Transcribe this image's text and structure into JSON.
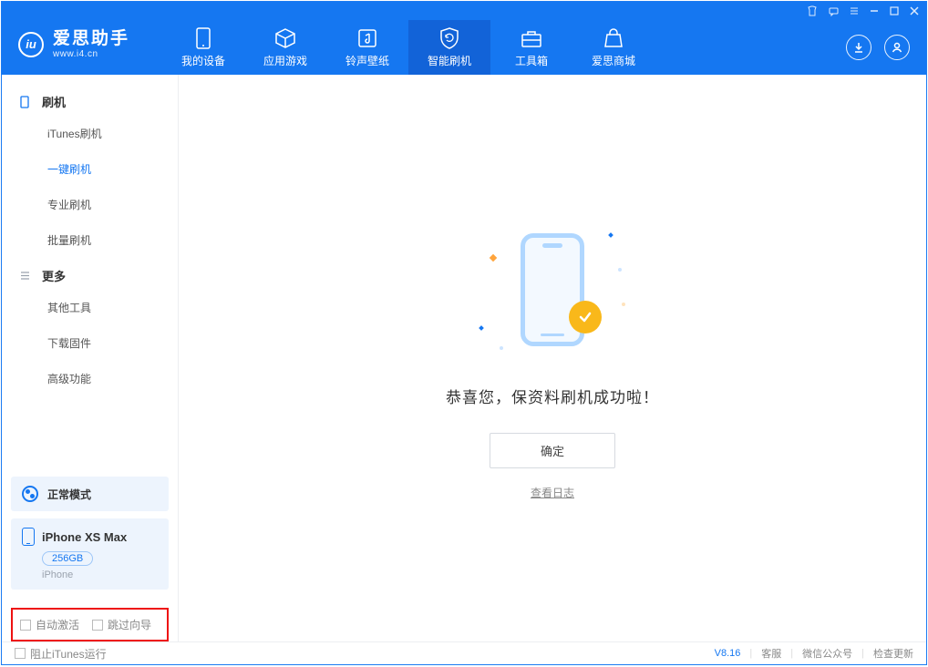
{
  "logo": {
    "title": "爱思助手",
    "subtitle": "www.i4.cn"
  },
  "nav": {
    "items": [
      {
        "label": "我的设备"
      },
      {
        "label": "应用游戏"
      },
      {
        "label": "铃声壁纸"
      },
      {
        "label": "智能刷机"
      },
      {
        "label": "工具箱"
      },
      {
        "label": "爱思商城"
      }
    ]
  },
  "sidebar": {
    "section1": {
      "title": "刷机",
      "items": [
        {
          "label": "iTunes刷机"
        },
        {
          "label": "一键刷机"
        },
        {
          "label": "专业刷机"
        },
        {
          "label": "批量刷机"
        }
      ]
    },
    "section2": {
      "title": "更多",
      "items": [
        {
          "label": "其他工具"
        },
        {
          "label": "下载固件"
        },
        {
          "label": "高级功能"
        }
      ]
    },
    "mode": {
      "label": "正常模式"
    },
    "device": {
      "name": "iPhone XS Max",
      "capacity": "256GB",
      "sub": "iPhone"
    },
    "options": {
      "opt1": "自动激活",
      "opt2": "跳过向导"
    }
  },
  "main": {
    "message": "恭喜您，保资料刷机成功啦！",
    "ok": "确定",
    "loglink": "查看日志"
  },
  "footer": {
    "block_itunes": "阻止iTunes运行",
    "version": "V8.16",
    "links": {
      "kefu": "客服",
      "wechat": "微信公众号",
      "update": "检查更新"
    }
  }
}
